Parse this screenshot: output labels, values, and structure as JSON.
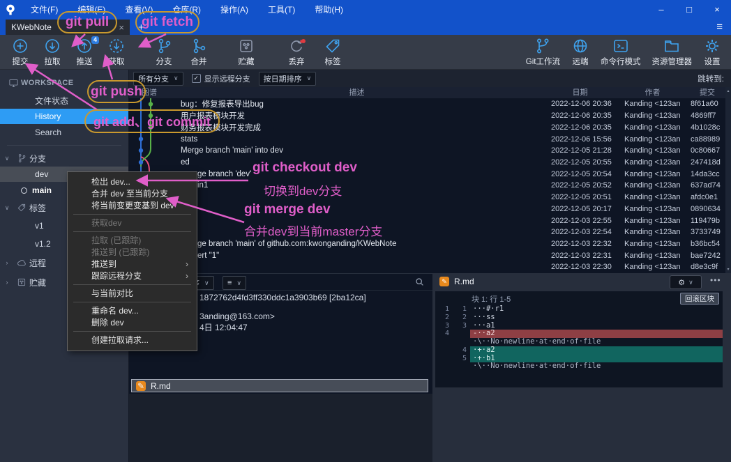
{
  "colors": {
    "titlebar_blue": "#1252ca",
    "selection_blue": "#2e9cf4",
    "icon_blue": "#3fa3ef",
    "graph_blue": "#2f6fd6",
    "graph_green": "#58b148",
    "graph_pink": "#e8507e",
    "diff_added_bg": "#11655f",
    "diff_removed_bg": "#8e3f44",
    "annotation_pink": "#e05ec9",
    "annotation_gold": "#c9992e",
    "badge_blue": "#2e7de0"
  },
  "titlebar": {
    "menu_items": [
      "文件(F)",
      "编辑(E)",
      "查看(V)",
      "仓库(R)",
      "操作(A)",
      "工具(T)",
      "帮助(H)"
    ],
    "controls": {
      "minimize": "–",
      "maximize": "□",
      "close": "×"
    }
  },
  "tabbar": {
    "active_tab": "KWebNote",
    "close": "×",
    "new_tab": "+",
    "menu_icon": "≡"
  },
  "toolbar": {
    "left": [
      {
        "name": "commit",
        "label": "提交",
        "icon": "plus-circle",
        "style": "blue"
      },
      {
        "name": "pull",
        "label": "拉取",
        "icon": "pull-circle",
        "style": "blue"
      },
      {
        "name": "push",
        "label": "推送",
        "icon": "push-circle",
        "style": "blue",
        "badge": "4"
      },
      {
        "name": "fetch",
        "label": "获取",
        "icon": "fetch-circle",
        "style": "blue"
      },
      {
        "name": "branch",
        "label": "分支",
        "icon": "branch",
        "style": "blue",
        "gap": 22
      },
      {
        "name": "merge",
        "label": "合并",
        "icon": "merge",
        "style": "blue",
        "gap": 4
      },
      {
        "name": "stash",
        "label": "贮藏",
        "icon": "stash",
        "style": "muted",
        "gap": 22
      },
      {
        "name": "discard",
        "label": "丢弃",
        "icon": "discard",
        "style": "muted",
        "gap": 26,
        "dot": true
      },
      {
        "name": "tag",
        "label": "标签",
        "icon": "tag",
        "style": "blue",
        "gap": 6
      }
    ],
    "right": [
      {
        "name": "gitflow",
        "label": "Git工作流",
        "icon": "gitflow"
      },
      {
        "name": "remote",
        "label": "远端",
        "icon": "globe"
      },
      {
        "name": "terminal",
        "label": "命令行模式",
        "icon": "terminal"
      },
      {
        "name": "explorer",
        "label": "资源管理器",
        "icon": "explorer"
      },
      {
        "name": "settings",
        "label": "设置",
        "icon": "gear"
      }
    ]
  },
  "sidebar": {
    "workspace": {
      "label": "WORKSPACE",
      "items": [
        {
          "label": "文件状态"
        },
        {
          "label": "History",
          "selected": true
        },
        {
          "label": "Search"
        }
      ]
    },
    "sections": [
      {
        "label": "分支",
        "expanded": true,
        "items": [
          {
            "label": "dev",
            "selected": true
          },
          {
            "label": "main",
            "current": true
          }
        ]
      },
      {
        "label": "标签",
        "expanded": true,
        "items": [
          {
            "label": "v1"
          },
          {
            "label": "v1.2"
          }
        ]
      },
      {
        "label": "远程",
        "expanded": false,
        "items": []
      },
      {
        "label": "贮藏",
        "expanded": false,
        "items": []
      }
    ]
  },
  "history": {
    "filter": {
      "branch_dropdown": "所有分支",
      "show_remote_label": "显示远程分支",
      "checked": "✓",
      "sort_dropdown": "按日期排序",
      "jump_to": "跳转到:"
    },
    "columns": [
      "图谱",
      "描述",
      "日期",
      "作者",
      "提交"
    ],
    "rows": [
      {
        "desc": "bug：修复报表导出bug",
        "date": "2022-12-06 20:36",
        "author": "Kanding <123an",
        "hash": "8f61a60"
      },
      {
        "desc": "用户报表模块开发",
        "date": "2022-12-06 20:35",
        "author": "Kanding <123an",
        "hash": "4869ff7"
      },
      {
        "desc": "财务报表模块开发完成",
        "date": "2022-12-06 20:35",
        "author": "Kanding <123an",
        "hash": "4b1028c"
      },
      {
        "desc": "stats",
        "date": "2022-12-06 15:56",
        "author": "Kanding <123an",
        "hash": "ca88989"
      },
      {
        "desc": "Merge branch 'main' into dev",
        "date": "2022-12-05 21:28",
        "author": "Kanding <123an",
        "hash": "0c80667"
      },
      {
        "desc": "ed",
        "date": "2022-12-05 20:55",
        "author": "Kanding <123an",
        "hash": "247418d"
      },
      {
        "desc": "ge branch 'dev'",
        "date": "2022-12-05 20:54",
        "author": "Kanding <123an",
        "hash": "14da3cc",
        "indent": true
      },
      {
        "desc": "in1",
        "date": "2022-12-05 20:52",
        "author": "Kanding <123an",
        "hash": "637ad74",
        "indent": true
      },
      {
        "desc": "",
        "date": "2022-12-05 20:51",
        "author": "Kanding <123an",
        "hash": "afdc0e1"
      },
      {
        "desc": "",
        "date": "2022-12-05 20:17",
        "author": "Kanding <123an",
        "hash": "0890634"
      },
      {
        "desc": "",
        "date": "2022-12-03 22:55",
        "author": "Kanding <123an",
        "hash": "119479b"
      },
      {
        "desc": "",
        "date": "2022-12-03 22:54",
        "author": "Kanding <123an",
        "hash": "3733749"
      },
      {
        "desc": "ge branch 'main' of github.com:kwonganding/KWebNote",
        "date": "2022-12-03 22:32",
        "author": "Kanding <123an",
        "hash": "b36bc54",
        "indent": true
      },
      {
        "desc": "ert \"1\"",
        "date": "2022-12-03 22:31",
        "author": "Kanding <123an",
        "hash": "bae7242",
        "indent": true
      },
      {
        "desc": "",
        "date": "2022-12-03 22:30",
        "author": "Kanding <123an",
        "hash": "d8e3c9f"
      }
    ]
  },
  "context_menu": {
    "items": [
      {
        "label": "检出 dev..."
      },
      {
        "label": "合并 dev 至当前分支"
      },
      {
        "label": "将当前变更变基到 dev"
      },
      {
        "sep": true
      },
      {
        "label": "获取dev",
        "disabled": true
      },
      {
        "sep": true
      },
      {
        "label": "拉取 (已跟踪)",
        "disabled": true
      },
      {
        "label": "推送到 (已跟踪)",
        "disabled": true
      },
      {
        "label": "推送到",
        "submenu": true
      },
      {
        "label": "跟踪远程分支",
        "submenu": true
      },
      {
        "sep": true
      },
      {
        "label": "与当前对比"
      },
      {
        "sep": true
      },
      {
        "label": "重命名 dev..."
      },
      {
        "label": "删除 dev"
      },
      {
        "sep": true
      },
      {
        "label": "创建拉取请求..."
      }
    ]
  },
  "detail_panel": {
    "sort_dropdown": "排序",
    "view_dropdown": "≡",
    "lines": [
      "1872762d4fd3ff330ddc1a3903b69 [2ba12ca]",
      "3anding@163.com>",
      "4日 12:04:47"
    ],
    "file": {
      "name": "R.md"
    }
  },
  "diff_panel": {
    "file": "R.md",
    "gear": "⚙",
    "more": "•••",
    "hunk_label": "块 1: 行 1-5",
    "revert_button": "回滚区块",
    "lines": [
      {
        "old": "1",
        "new": "1",
        "text": "···#·r1",
        "type": "ctx"
      },
      {
        "old": "2",
        "new": "2",
        "text": "···ss",
        "type": "ctx"
      },
      {
        "old": "3",
        "new": "3",
        "text": "···a1",
        "type": "ctx"
      },
      {
        "old": "4",
        "new": "",
        "text": "-··a2",
        "type": "del"
      },
      {
        "old": "",
        "new": "",
        "text": "·\\··No·newline·at·end·of·file",
        "type": "meta"
      },
      {
        "old": "",
        "new": "4",
        "text": "·+·a2",
        "type": "add"
      },
      {
        "old": "",
        "new": "5",
        "text": "·+·b1",
        "type": "add"
      },
      {
        "old": "",
        "new": "",
        "text": "·\\··No·newline·at·end·of·file",
        "type": "meta"
      }
    ]
  },
  "annotations": {
    "pull": "git pull",
    "fetch": "git fetch",
    "push": "git push",
    "add_commit": "git add、git commit",
    "checkout_cmd": "git checkout dev",
    "checkout_desc": "切换到dev分支",
    "merge_cmd": "git merge dev",
    "merge_desc": "合并dev到当前master分支"
  }
}
